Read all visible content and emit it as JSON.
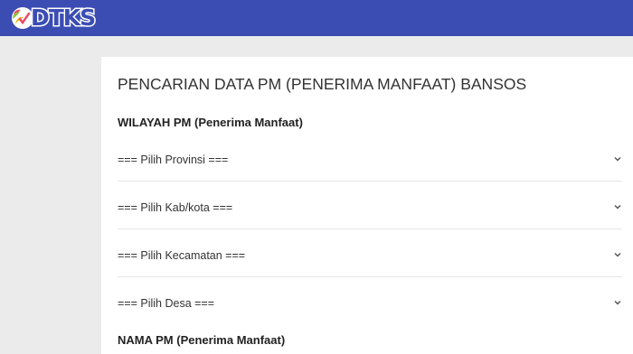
{
  "header": {
    "logo_text": "DTKS",
    "brand_color": "#3b4db3"
  },
  "form": {
    "title": "PENCARIAN DATA PM (PENERIMA MANFAAT) BANSOS",
    "wilayah_label": "WILAYAH PM (Penerima Manfaat)",
    "provinsi": "=== Pilih Provinsi ===",
    "kabkota": "=== Pilih Kab/kota ===",
    "kecamatan": "=== Pilih Kecamatan ===",
    "desa": "=== Pilih Desa ===",
    "nama_label": "NAMA PM (Penerima Manfaat)"
  },
  "icons": [
    "dtks-logo-icon",
    "chevron-down-icon"
  ]
}
